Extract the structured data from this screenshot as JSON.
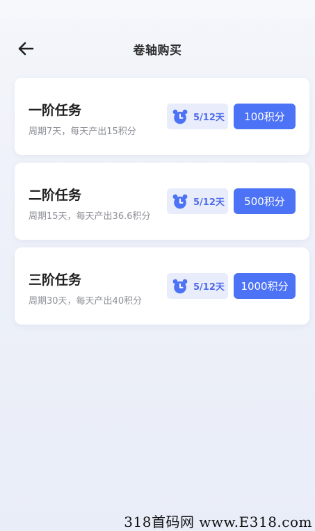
{
  "header": {
    "title": "卷轴购买",
    "back_icon": "arrow-left-icon"
  },
  "cards": [
    {
      "title": "一阶任务",
      "desc": "周期7天，每天产出15积分",
      "days": "5/12天",
      "price": "100积分"
    },
    {
      "title": "二阶任务",
      "desc": "周期15天，每天产出36.6积分",
      "days": "5/12天",
      "price": "500积分"
    },
    {
      "title": "三阶任务",
      "desc": "周期30天，每天产出40积分",
      "days": "5/12天",
      "price": "1000积分"
    }
  ],
  "clock_icon": "alarm-clock-icon",
  "colors": {
    "accent": "#4c72f6",
    "chip_bg": "#e9edfb",
    "chip_text": "#4f6bea"
  },
  "watermark": "318首码网 www.E318.com"
}
